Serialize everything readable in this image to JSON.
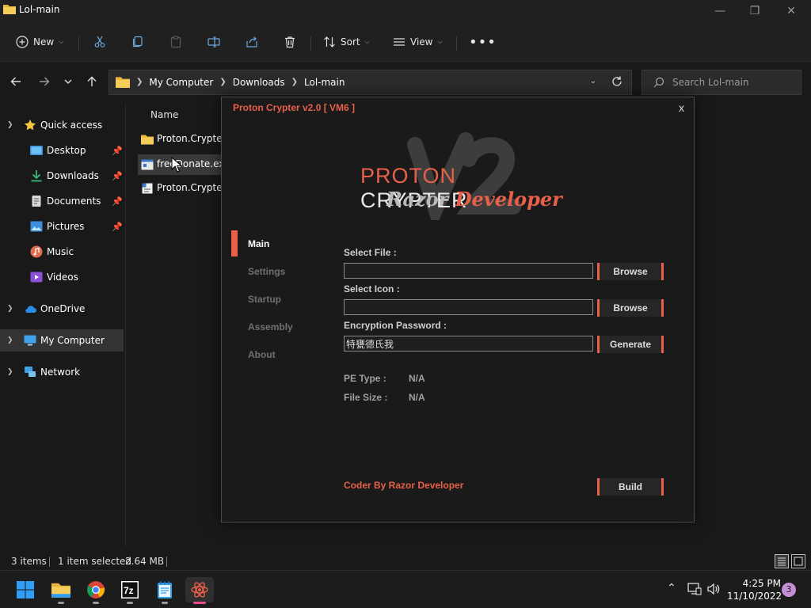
{
  "window": {
    "title": "Lol-main"
  },
  "command_bar": {
    "new_label": "New",
    "sort_label": "Sort",
    "view_label": "View"
  },
  "address": {
    "crumbs": [
      "My Computer",
      "Downloads",
      "Lol-main"
    ],
    "search_placeholder": "Search Lol-main"
  },
  "nav_pane": {
    "quick_access": "Quick access",
    "items": [
      "Desktop",
      "Downloads",
      "Documents",
      "Pictures",
      "Music",
      "Videos"
    ],
    "onedrive": "OneDrive",
    "my_computer": "My Computer",
    "network": "Network"
  },
  "file_list": {
    "column_name": "Name",
    "files": [
      {
        "name": "Proton.Crypter.",
        "icon": "folder-icon"
      },
      {
        "name": "freeDonate.exe",
        "icon": "exe-icon"
      },
      {
        "name": "Proton.Crypter.",
        "icon": "config-icon"
      }
    ]
  },
  "status_bar": {
    "items_count": "3 items",
    "selected": "1 item selected",
    "size": "2.64 MB"
  },
  "taskbar": {
    "apps": [
      "start-icon",
      "file-explorer-icon",
      "chrome-icon",
      "7zip-icon",
      "notepad-icon",
      "proton-crypter-icon"
    ],
    "time": "4:25 PM",
    "date": "11/10/2022",
    "notifications": "3"
  },
  "crypter": {
    "title": "Proton Crypter v2.0 [ VM6 ]",
    "close": "x",
    "logo": {
      "word1": "PROTON",
      "word2": "CRYPTER",
      "sub1": "Razor",
      "sub2": "Developer"
    },
    "menu": [
      "Main",
      "Settings",
      "Startup",
      "Assembly",
      "About"
    ],
    "select_file_label": "Select File :",
    "select_icon_label": "Select Icon :",
    "password_label": "Encryption Password :",
    "file_value": "",
    "icon_value": "",
    "password_value": "特甕德氏我",
    "browse_label": "Browse",
    "generate_label": "Generate",
    "pe_type_label": "PE Type :",
    "pe_type_value": "N/A",
    "file_size_label": "File Size :",
    "file_size_value": "N/A",
    "coder": "Coder By Razor Developer",
    "build_label": "Build",
    "accent_color": "#e8604a"
  }
}
